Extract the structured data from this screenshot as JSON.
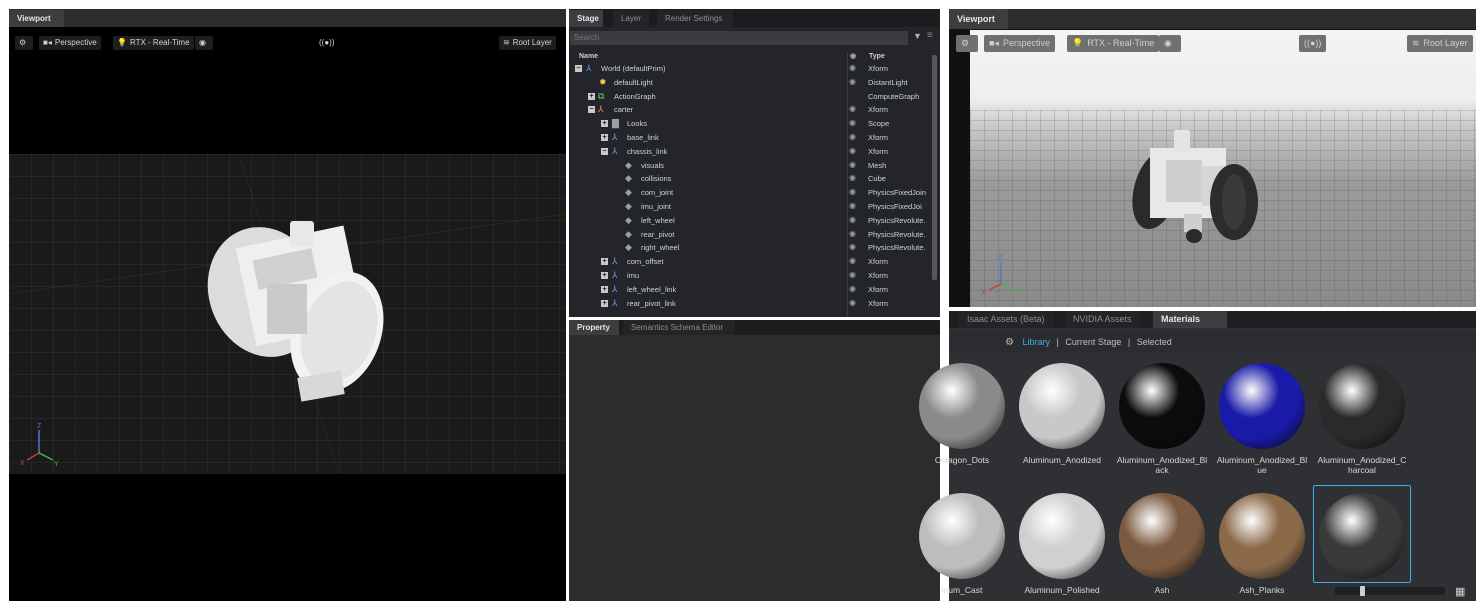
{
  "viewport_left": {
    "tab": "Viewport",
    "toolbar": {
      "perspective": "Perspective",
      "renderer": "RTX - Real-Time",
      "broadcast": "((●))",
      "root_layer": "Root Layer"
    },
    "axis": {
      "x": "X",
      "y": "Y",
      "z": "Z"
    }
  },
  "stage": {
    "tabs": [
      "Stage",
      "Layer",
      "Render Settings"
    ],
    "search_placeholder": "Search",
    "columns": {
      "name": "Name",
      "type": "Type"
    },
    "rows": [
      {
        "name": "World (defaultPrim)",
        "type": "Xform"
      },
      {
        "name": "defaultLight",
        "type": "DistantLight"
      },
      {
        "name": "ActionGraph",
        "type": "ComputeGraph"
      },
      {
        "name": "carter",
        "type": "Xform"
      },
      {
        "name": "Looks",
        "type": "Scope"
      },
      {
        "name": "base_link",
        "type": "Xform"
      },
      {
        "name": "chassis_link",
        "type": "Xform"
      },
      {
        "name": "visuals",
        "type": "Mesh"
      },
      {
        "name": "collisions",
        "type": "Cube"
      },
      {
        "name": "com_joint",
        "type": "PhysicsFixedJoin"
      },
      {
        "name": "imu_joint",
        "type": "PhysicsFixedJoi"
      },
      {
        "name": "left_wheel",
        "type": "PhysicsRevolute."
      },
      {
        "name": "rear_pivot",
        "type": "PhysicsRevolute."
      },
      {
        "name": "right_wheel",
        "type": "PhysicsRevolute."
      },
      {
        "name": "com_offset",
        "type": "Xform"
      },
      {
        "name": "imu",
        "type": "Xform"
      },
      {
        "name": "left_wheel_link",
        "type": "Xform"
      },
      {
        "name": "rear_pivot_link",
        "type": "Xform"
      }
    ]
  },
  "property": {
    "tabs": [
      "Property",
      "Semantics Schema Editor"
    ]
  },
  "viewport_right": {
    "tab": "Viewport",
    "toolbar": {
      "perspective": "Perspective",
      "renderer": "RTX - Real-Time",
      "broadcast": "((●))",
      "root_layer": "Root Layer"
    },
    "axis": {
      "x": "X",
      "y": "Y",
      "z": "Z"
    }
  },
  "assets": {
    "tabs": [
      "Isaac Assets (Beta)",
      "NVIDIA Assets",
      "Materials"
    ],
    "filters": {
      "library": "Library",
      "current_stage": "Current Stage",
      "selected": "Selected"
    },
    "materials": [
      {
        "label": "Octagon_Dots",
        "color": "#8a8a8a"
      },
      {
        "label": "Aluminum_Anodized",
        "color": "#c8c8c8"
      },
      {
        "label": "Aluminum_Anodized_Bl ack",
        "color": "#0c0c0c"
      },
      {
        "label": "Aluminum_Anodized_Bl ue",
        "color": "#1a1aa8"
      },
      {
        "label": "Aluminum_Anodized_C harcoal",
        "color": "#2a2a2a"
      },
      {
        "label": "inum_Cast",
        "color": "#bdbdbd"
      },
      {
        "label": "Aluminum_Polished",
        "color": "#d0d0d0"
      },
      {
        "label": "Ash",
        "color": "#7a5a40"
      },
      {
        "label": "Ash_Planks",
        "color": "#8b6a4a"
      },
      {
        "label": "",
        "color": "#3a3a3a"
      }
    ]
  }
}
